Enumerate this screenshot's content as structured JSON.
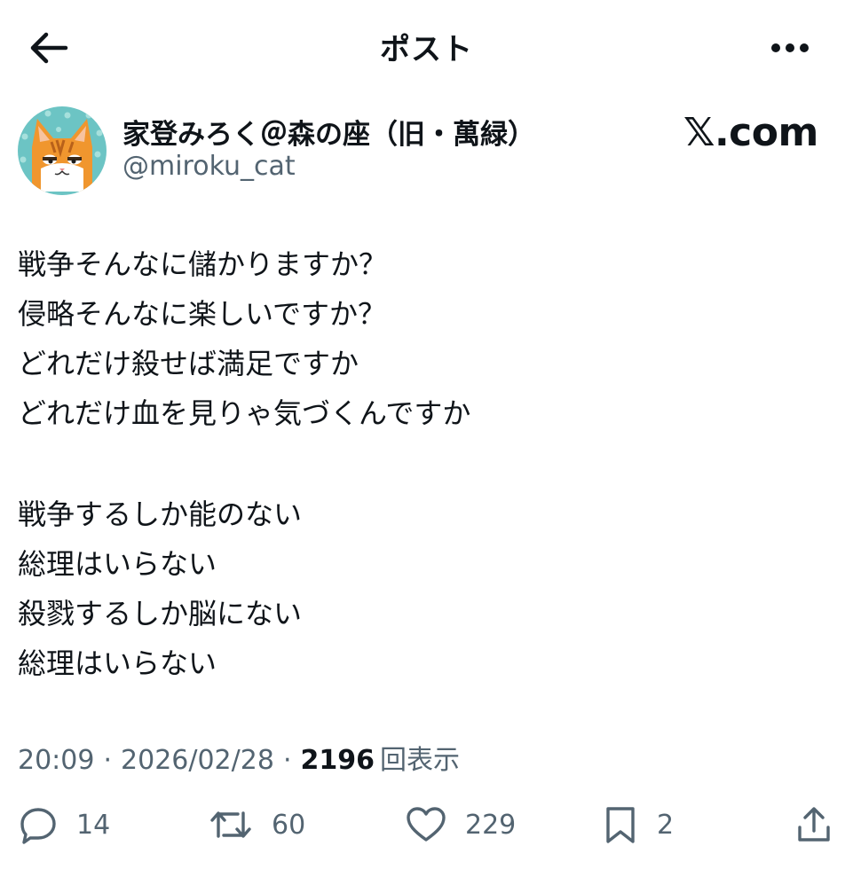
{
  "header": {
    "title": "ポスト",
    "back_icon": "arrow-left-icon",
    "more_icon": "more-horizontal-icon"
  },
  "author": {
    "display_name": "家登みろく＠森の座（旧・萬緑）",
    "handle": "@miroku_cat",
    "avatar_icon": "cat-avatar"
  },
  "brand": "𝕏.com",
  "tweet": {
    "lines": [
      "戦争そんなに儲かりますか？",
      "侵略そんなに楽しいですか？",
      "どれだけ殺せば満足ですか",
      "どれだけ血を見りゃ気づくんですか",
      "",
      "戦争するしか能のない",
      "総理はいらない",
      "殺戮するしか脳にない",
      "総理はいらない"
    ]
  },
  "meta": {
    "time": "20:09",
    "separator": "·",
    "date": "2026/02/28",
    "views_count": "2196",
    "views_label": "回表示"
  },
  "actions": {
    "reply_count": "14",
    "retweet_count": "60",
    "like_count": "229",
    "bookmark_count": "2",
    "reply_icon": "reply-icon",
    "retweet_icon": "retweet-icon",
    "like_icon": "heart-icon",
    "bookmark_icon": "bookmark-icon",
    "share_icon": "share-icon"
  },
  "colors": {
    "text": "#0f1419",
    "secondary": "#536471",
    "avatar_bg": "#6cc4c4",
    "cat_orange": "#f0962e"
  }
}
